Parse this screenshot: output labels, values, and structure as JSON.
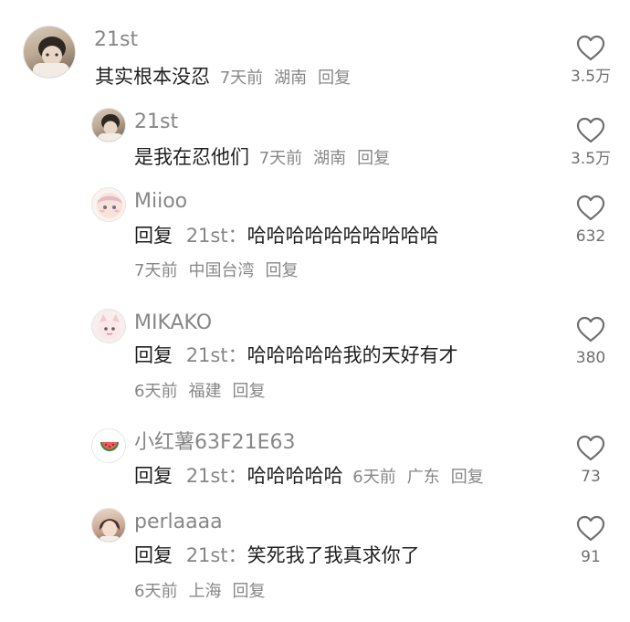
{
  "comments": [
    {
      "username": "21st",
      "text": "其实根本没忍",
      "time": "7天前",
      "location": "湖南",
      "reply_label": "回复",
      "likes": "3.5万"
    },
    {
      "username": "21st",
      "text": "是我在忍他们",
      "time": "7天前",
      "location": "湖南",
      "reply_label": "回复",
      "likes": "3.5万"
    },
    {
      "username": "Miioo",
      "reply_prefix": "回复",
      "reply_target": "21st：",
      "text": "哈哈哈哈哈哈哈哈哈哈",
      "time": "7天前",
      "location": "中国台湾",
      "reply_label": "回复",
      "likes": "632"
    },
    {
      "username": "MIKAKO",
      "reply_prefix": "回复",
      "reply_target": "21st：",
      "text": "哈哈哈哈哈我的天好有才",
      "time": "6天前",
      "location": "福建",
      "reply_label": "回复",
      "likes": "380"
    },
    {
      "username": "小红薯63F21E63",
      "reply_prefix": "回复",
      "reply_target": "21st：",
      "text": "哈哈哈哈哈",
      "time": "6天前",
      "location": "广东",
      "reply_label": "回复",
      "likes": "73"
    },
    {
      "username": "perlaaaa",
      "reply_prefix": "回复",
      "reply_target": "21st：",
      "text": "笑死我了我真求你了",
      "time": "6天前",
      "location": "上海",
      "reply_label": "回复",
      "likes": "91"
    }
  ],
  "icons": {
    "like": "heart-outline-icon",
    "watermelon_avatar": "watermelon-icon"
  },
  "colors": {
    "text_primary": "#1f1f1f",
    "text_secondary": "#878787",
    "heart_stroke": "#6f6f6f"
  }
}
